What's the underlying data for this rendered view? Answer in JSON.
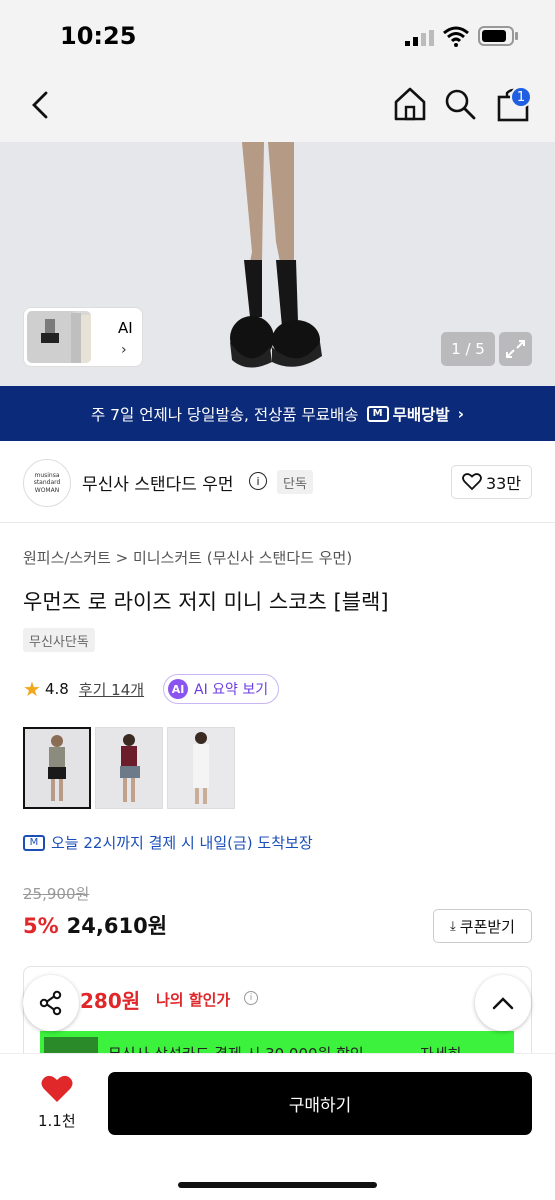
{
  "status": {
    "time": "10:25"
  },
  "nav": {
    "cart_count": "1"
  },
  "hero": {
    "thumb_label": "AI",
    "pager": "1 / 5"
  },
  "banner": {
    "text": "주 7일 언제나 당일발송, 전상품 무료배송",
    "badge": "무배당발",
    "m_icon": "M"
  },
  "brand": {
    "logo_text": "musinsa standard WOMAN",
    "name": "무신사 스탠다드 우먼",
    "tag": "단독",
    "likes": "33만"
  },
  "product": {
    "breadcrumb": "원피스/스커트 > 미니스커트 (무신사 스탠다드 우먼)",
    "title": "우먼즈 로 라이즈 저지 미니 스코츠 [블랙]",
    "exclusive": "무신사단독",
    "rating": "4.8",
    "reviews": "후기 14개",
    "ai_summary": "AI 요약 보기",
    "ai_badge": "AI"
  },
  "delivery": {
    "text": "오늘 22시까지 결제 시 내일(금) 도착보장",
    "m_icon": "M"
  },
  "price": {
    "original": "25,900원",
    "rate": "5%",
    "final": "24,610원",
    "coupon": "쿠폰받기"
  },
  "discount": {
    "amount": "280원",
    "label": "나의 할인가",
    "card_text": "무신사 삼성카드 결제 시 30,000원 할인",
    "more": "자세히"
  },
  "bottom": {
    "like_count": "1.1천",
    "buy": "구매하기"
  },
  "colors": {
    "accent_blue": "#0b2a7a",
    "sale_red": "#e0272a",
    "badge_blue": "#1f5fe0",
    "ai_purple": "#8a54f0"
  }
}
